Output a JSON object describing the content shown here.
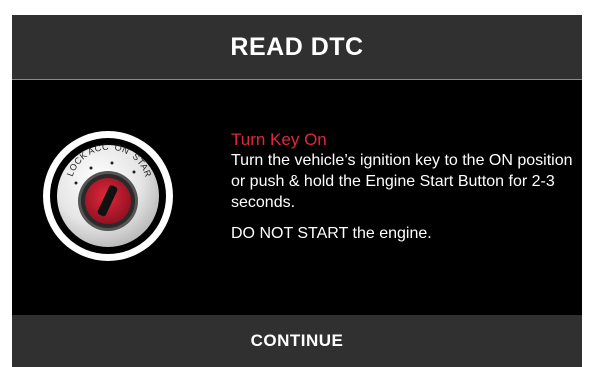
{
  "dialog": {
    "title": "READ DTC",
    "continue_label": "CONTINUE"
  },
  "instructions": {
    "title": "Turn Key On",
    "body": "Turn the vehicle’s ignition key to the ON position or push & hold the Engine Start Button for 2-3 seconds.",
    "warning": "DO NOT START the engine."
  },
  "ignition": {
    "icon": "ignition-key-icon",
    "positions": [
      "LOCK",
      "ACC",
      "ON",
      "START"
    ]
  },
  "colors": {
    "accent": "#e0283a",
    "header_bg": "#303030",
    "body_bg": "#000000",
    "text": "#ffffff"
  }
}
